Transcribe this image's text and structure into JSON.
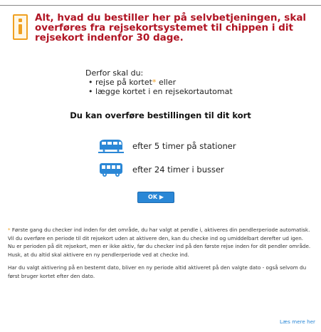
{
  "alert": {
    "icon": "info-icon",
    "accent_color": "#b01524",
    "icon_color": "#f0a020",
    "text": "Alt, hvad du bestiller her på selvbetjeningen, skal overføres fra rejsekortsystemet til chippen i dit rejsekort indenfor 30 dage."
  },
  "instructions": {
    "heading": "Derfor skal du:",
    "items": [
      {
        "text": "rejse på kortet",
        "marker": "*",
        "suffix": " eller"
      },
      {
        "text": "lægge kortet i en rejsekortautomat"
      }
    ]
  },
  "transfer": {
    "title": "Du kan overføre bestillingen til dit kort",
    "methods": [
      {
        "icon": "train-icon",
        "text": "efter 5 timer på stationer"
      },
      {
        "icon": "bus-icon",
        "text": "efter 24 timer i busser"
      }
    ]
  },
  "ok_button": {
    "label": "OK ▶",
    "color": "#2a87d6"
  },
  "footnotes": [
    {
      "marker": "*",
      "text": " Første gang du checker ind inden for det område, du har valgt at pendle i, aktiveres din pendlerperiode automatisk."
    },
    {
      "text": "Vil du overføre en periode til dit rejsekort uden at aktivere den, kan du checke ind og umiddelbart derefter ud igen."
    },
    {
      "text": "Nu er perioden på dit rejsekort, men er ikke aktiv, før du checker ind på den første rejse inden for dit pendler område. Husk, at du altid skal aktivere en ny pendlerperiode ved at checke ind."
    },
    {
      "text": "Har du valgt aktivering på en bestemt dato, bliver en ny periode altid aktiveret på den valgte dato - også selvom du først bruger kortet efter den dato."
    }
  ],
  "read_more": "Læs mere her"
}
